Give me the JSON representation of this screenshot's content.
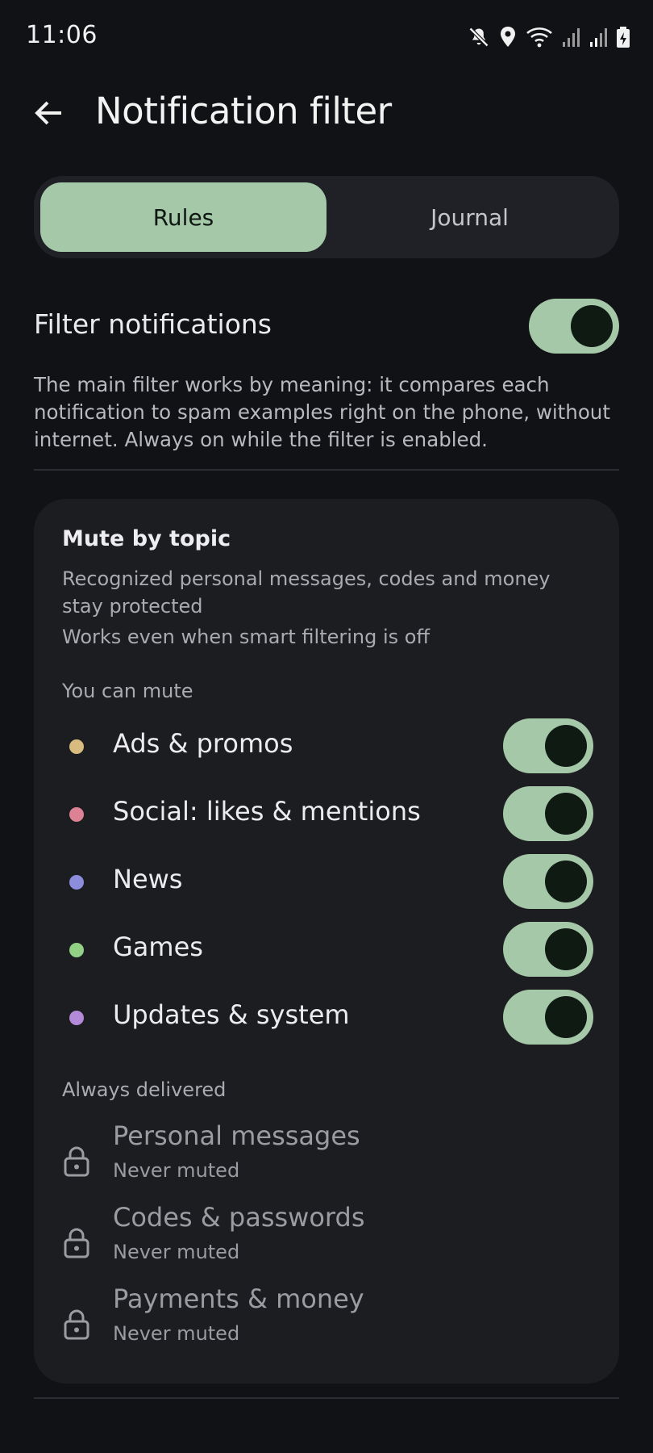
{
  "status_bar": {
    "time": "11:06"
  },
  "header": {
    "title": "Notification filter"
  },
  "tabs": [
    {
      "label": "Rules",
      "active": true
    },
    {
      "label": "Journal",
      "active": false
    }
  ],
  "filter": {
    "label": "Filter notifications",
    "enabled": true,
    "description": "The main filter works by meaning: it compares each notification to spam examples right on the phone, without internet. Always on while the filter is enabled."
  },
  "mute_card": {
    "title": "Mute by topic",
    "subtitle": "Recognized personal messages, codes and money stay protected",
    "note": "Works even when smart filtering is off",
    "mutable_header": "You can mute",
    "topics": [
      {
        "label": "Ads & promos",
        "dot_color": "#d7bb7f",
        "enabled": true
      },
      {
        "label": "Social: likes & mentions",
        "dot_color": "#dd8194",
        "enabled": true
      },
      {
        "label": "News",
        "dot_color": "#8c8edd",
        "enabled": true
      },
      {
        "label": "Games",
        "dot_color": "#92d086",
        "enabled": true
      },
      {
        "label": "Updates & system",
        "dot_color": "#b28ad8",
        "enabled": true
      }
    ],
    "always_header": "Always delivered",
    "always": [
      {
        "label": "Personal messages",
        "note": "Never muted",
        "icon": "lock-icon"
      },
      {
        "label": "Codes & passwords",
        "note": "Never muted",
        "icon": "lock-icon"
      },
      {
        "label": "Payments & money",
        "note": "Never muted",
        "icon": "lock-icon"
      }
    ]
  },
  "colors": {
    "background": "#111215",
    "accent": "#a4c8a8",
    "card": "#1c1d21"
  }
}
